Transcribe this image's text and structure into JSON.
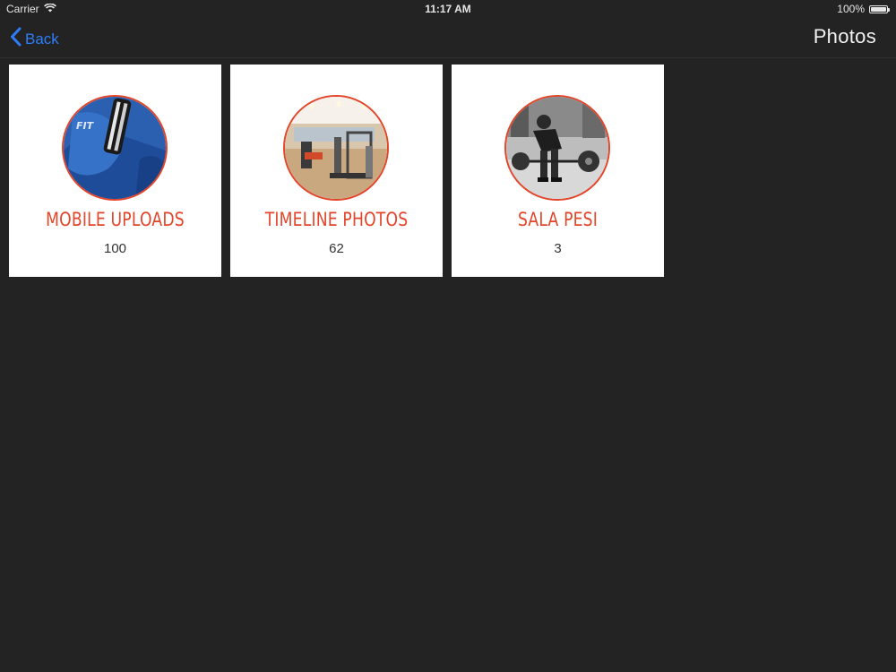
{
  "status_bar": {
    "carrier": "Carrier",
    "time": "11:17 AM",
    "battery": "100%"
  },
  "nav": {
    "back_label": "Back",
    "title": "Photos"
  },
  "colors": {
    "background": "#232323",
    "accent": "#e3452a",
    "link": "#2f7df6"
  },
  "albums": [
    {
      "name": "MOBILE UPLOADS",
      "count": "100",
      "thumbnail": "blue-jersey-photo"
    },
    {
      "name": "TIMELINE PHOTOS",
      "count": "62",
      "thumbnail": "gym-interior-photo"
    },
    {
      "name": "SALA PESI",
      "count": "3",
      "thumbnail": "deadlift-photo"
    }
  ]
}
